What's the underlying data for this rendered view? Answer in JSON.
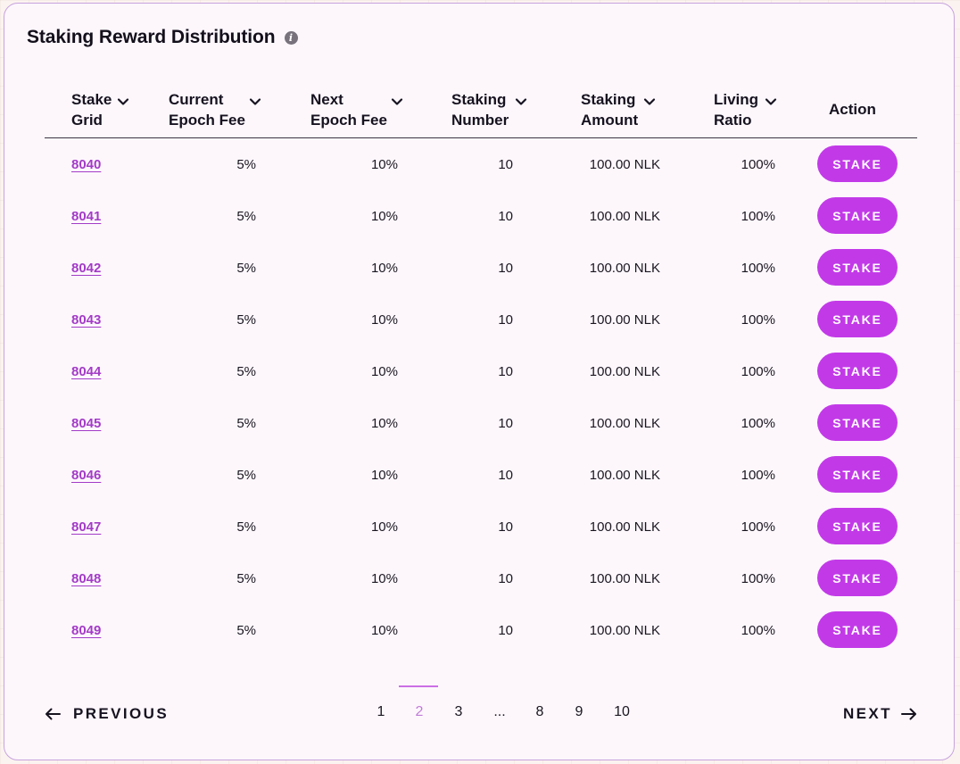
{
  "title": "Staking Reward Distribution",
  "info_icon": "info-icon",
  "columns": {
    "stake_grid": [
      "Stake",
      "Grid"
    ],
    "current_epoch_fee": [
      "Current",
      "Epoch Fee"
    ],
    "next_epoch_fee": [
      "Next",
      "Epoch Fee"
    ],
    "staking_number": [
      "Staking",
      "Number"
    ],
    "staking_amount": [
      "Staking",
      "Amount"
    ],
    "living_ratio": [
      "Living",
      "Ratio"
    ],
    "action": "Action"
  },
  "rows": [
    {
      "grid": "8040",
      "current_fee": "5%",
      "next_fee": "10%",
      "number": "10",
      "amount": "100.00 NLK",
      "ratio": "100%",
      "action": "STAKE"
    },
    {
      "grid": "8041",
      "current_fee": "5%",
      "next_fee": "10%",
      "number": "10",
      "amount": "100.00 NLK",
      "ratio": "100%",
      "action": "STAKE"
    },
    {
      "grid": "8042",
      "current_fee": "5%",
      "next_fee": "10%",
      "number": "10",
      "amount": "100.00 NLK",
      "ratio": "100%",
      "action": "STAKE"
    },
    {
      "grid": "8043",
      "current_fee": "5%",
      "next_fee": "10%",
      "number": "10",
      "amount": "100.00 NLK",
      "ratio": "100%",
      "action": "STAKE"
    },
    {
      "grid": "8044",
      "current_fee": "5%",
      "next_fee": "10%",
      "number": "10",
      "amount": "100.00 NLK",
      "ratio": "100%",
      "action": "STAKE"
    },
    {
      "grid": "8045",
      "current_fee": "5%",
      "next_fee": "10%",
      "number": "10",
      "amount": "100.00 NLK",
      "ratio": "100%",
      "action": "STAKE"
    },
    {
      "grid": "8046",
      "current_fee": "5%",
      "next_fee": "10%",
      "number": "10",
      "amount": "100.00 NLK",
      "ratio": "100%",
      "action": "STAKE"
    },
    {
      "grid": "8047",
      "current_fee": "5%",
      "next_fee": "10%",
      "number": "10",
      "amount": "100.00 NLK",
      "ratio": "100%",
      "action": "STAKE"
    },
    {
      "grid": "8048",
      "current_fee": "5%",
      "next_fee": "10%",
      "number": "10",
      "amount": "100.00 NLK",
      "ratio": "100%",
      "action": "STAKE"
    },
    {
      "grid": "8049",
      "current_fee": "5%",
      "next_fee": "10%",
      "number": "10",
      "amount": "100.00 NLK",
      "ratio": "100%",
      "action": "STAKE"
    }
  ],
  "pagination": {
    "previous_label": "PREVIOUS",
    "next_label": "NEXT",
    "pages": [
      "1",
      "2",
      "3",
      "...",
      "8",
      "9",
      "10"
    ],
    "current_page": "2"
  },
  "colors": {
    "accent": "#c23ae8",
    "link": "#a33bc7",
    "card_border": "#c7a3dd",
    "background": "#fbf3f0"
  }
}
